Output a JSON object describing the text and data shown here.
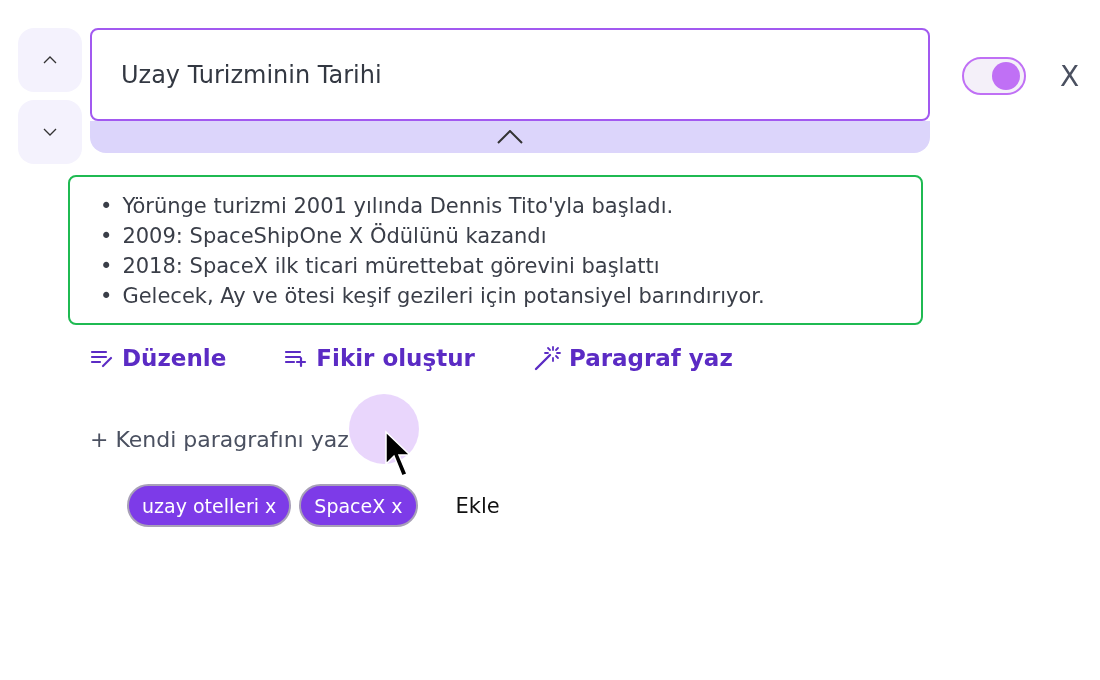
{
  "title_field": {
    "value": "Uzay Turizminin Tarihi"
  },
  "toggle": {
    "on": true
  },
  "close": "X",
  "bullets": [
    {
      "marker": "•",
      "text": "Yörünge turizmi 2001 yılında Dennis Tito'yla başladı."
    },
    {
      "marker": "•",
      "text": "2009: SpaceShipOne X Ödülünü kazandı"
    },
    {
      "marker": "•",
      "text": "2018: SpaceX ilk ticari mürettebat görevini başlattı"
    },
    {
      "marker": "•",
      "text": "Gelecek, Ay ve ötesi keşif gezileri için potansiyel barındırıyor."
    }
  ],
  "actions": [
    {
      "kind": "edit",
      "label": "Düzenle"
    },
    {
      "kind": "idea",
      "label": "Fikir oluştur"
    },
    {
      "kind": "magic",
      "label": "Paragraf yaz"
    }
  ],
  "own_paragraph": "+ Kendi paragrafını yaz",
  "tags": [
    "uzay otelleri x",
    "SpaceX x"
  ],
  "add_tag": "Ekle"
}
